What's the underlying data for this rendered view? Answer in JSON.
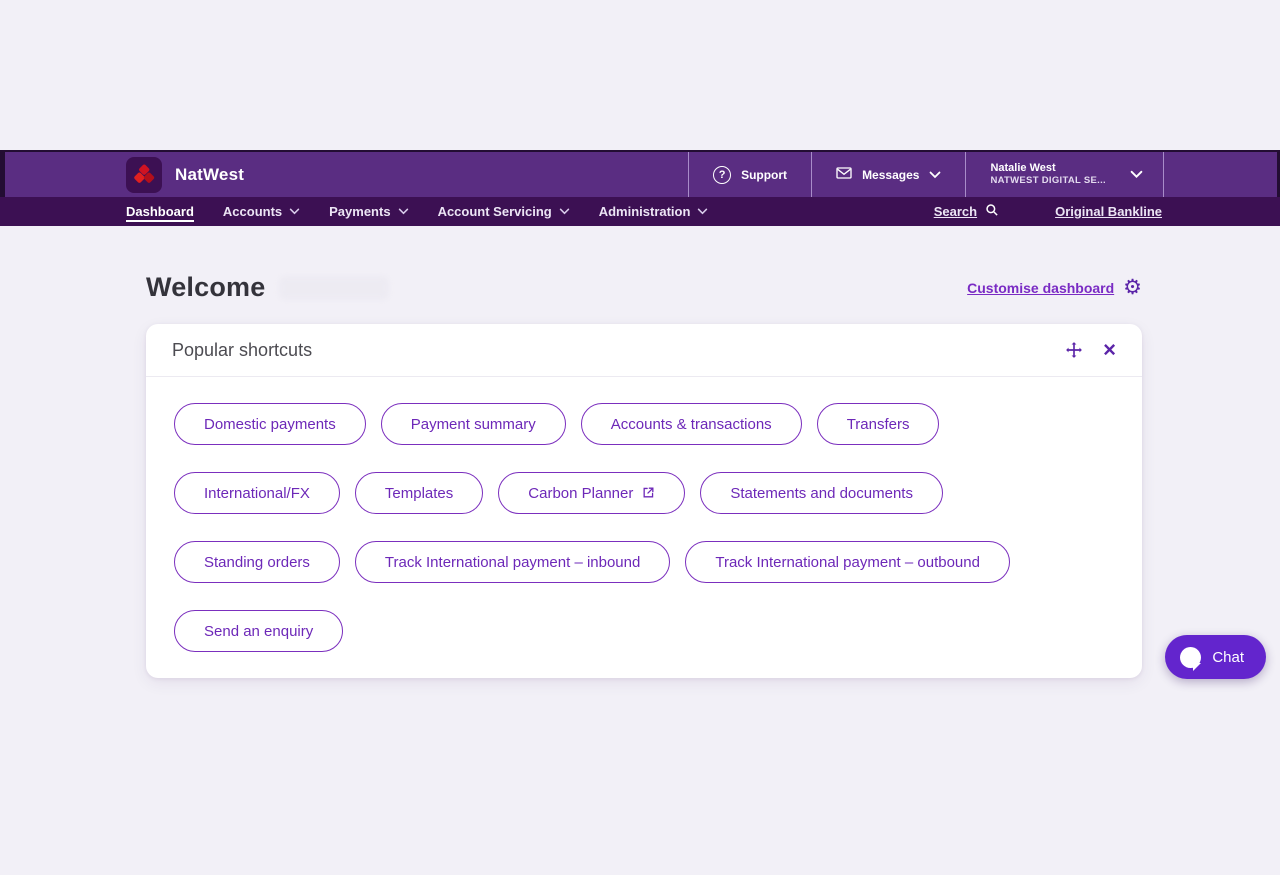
{
  "colors": {
    "page_bg": "#f2f0f7",
    "header_purple": "#5a2d82",
    "nav_purple": "#3c1053",
    "accent_purple": "#6d28b8",
    "pill_border": "#7b2fbe",
    "link_purple": "#7a2bc4",
    "chat_purple": "#6325cd",
    "brand_red": "#d9222a"
  },
  "header": {
    "brand": "NatWest",
    "support": {
      "label": "Support",
      "icon": "?"
    },
    "messages": {
      "label": "Messages"
    },
    "user": {
      "name": "Natalie West",
      "org": "NATWEST DIGITAL SE..."
    }
  },
  "nav": {
    "items": [
      {
        "label": "Dashboard",
        "active": true
      },
      {
        "label": "Accounts",
        "active": false
      },
      {
        "label": "Payments",
        "active": false
      },
      {
        "label": "Account Servicing",
        "active": false
      },
      {
        "label": "Administration",
        "active": false
      }
    ],
    "search_label": "Search",
    "bankline_label": "Original Bankline"
  },
  "main": {
    "welcome_title": "Welcome",
    "customise_label": "Customise dashboard",
    "gear_icon": "⚙"
  },
  "shortcuts": {
    "title": "Popular shortcuts",
    "close_icon": "×",
    "items": [
      {
        "label": "Domestic payments"
      },
      {
        "label": "Payment summary"
      },
      {
        "label": "Accounts & transactions"
      },
      {
        "label": "Transfers"
      },
      {
        "label": "International/FX"
      },
      {
        "label": "Templates"
      },
      {
        "label": "Carbon Planner",
        "external": true
      },
      {
        "label": "Statements and documents"
      },
      {
        "label": "Standing orders"
      },
      {
        "label": "Track International payment – inbound"
      },
      {
        "label": "Track International payment – outbound"
      },
      {
        "label": "Send an enquiry"
      }
    ]
  },
  "chat": {
    "label": "Chat"
  }
}
